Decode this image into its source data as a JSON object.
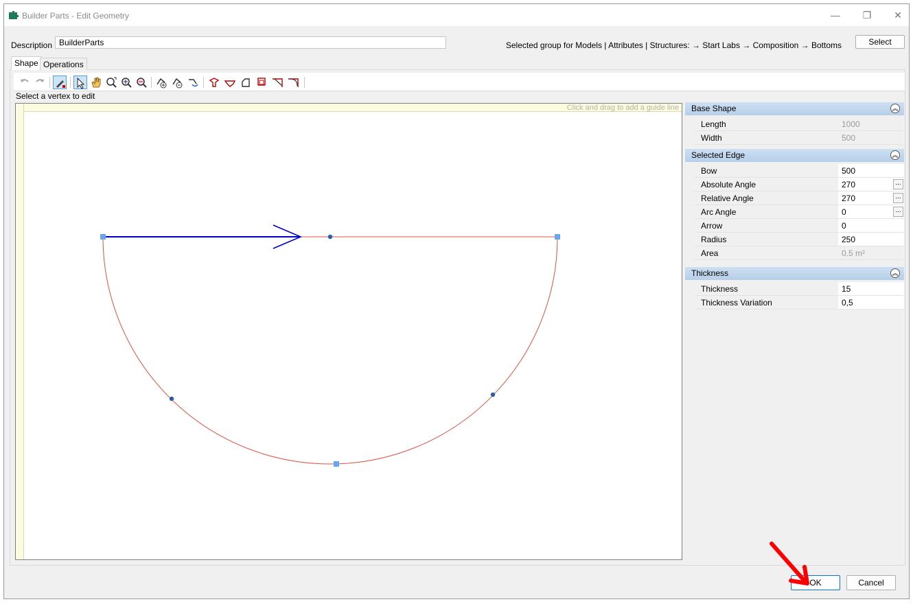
{
  "window": {
    "title": "Builder Parts - Edit Geometry",
    "controls": {
      "minimize": "—",
      "restore": "❐",
      "close": "✕"
    }
  },
  "description": {
    "label": "Description",
    "value": "BuilderParts"
  },
  "group": {
    "text": "Selected group for Models | Attributes | Structures:  → Start Labs → Composition → Bottoms",
    "select_label": "Select"
  },
  "tabs": [
    {
      "label": "Shape",
      "active": true
    },
    {
      "label": "Operations",
      "active": false
    }
  ],
  "toolbar": {
    "icons": [
      "undo-icon",
      "redo-icon",
      "edit-vertex-icon",
      "select-pointer-icon",
      "pan-hand-icon",
      "zoom-fit-icon",
      "zoom-in-icon",
      "zoom-out-icon",
      "add-vertex-icon",
      "remove-vertex-icon",
      "split-edge-icon",
      "corner-shape-1-icon",
      "corner-shape-2-icon",
      "corner-shape-3-icon",
      "corner-shape-4-icon",
      "chamfer-icon",
      "fillet-icon"
    ]
  },
  "hint": "Select a vertex to edit",
  "canvas": {
    "guide_hint": "Click and drag to add a guide line"
  },
  "properties": {
    "base_shape": {
      "title": "Base Shape",
      "rows": [
        {
          "name": "Length",
          "value": "1000"
        },
        {
          "name": "Width",
          "value": "500"
        }
      ]
    },
    "selected_edge": {
      "title": "Selected Edge",
      "rows": [
        {
          "name": "Bow",
          "value": "500"
        },
        {
          "name": "Absolute Angle",
          "value": "270"
        },
        {
          "name": "Relative Angle",
          "value": "270"
        },
        {
          "name": "Arc Angle",
          "value": "0"
        },
        {
          "name": "Arrow",
          "value": "0"
        },
        {
          "name": "Radius",
          "value": "250"
        },
        {
          "name": "Area",
          "value": "0.5 m²"
        }
      ]
    },
    "thickness": {
      "title": "Thickness",
      "rows": [
        {
          "name": "Thickness",
          "value": "15"
        },
        {
          "name": "Thickness Variation",
          "value": "0,5"
        }
      ]
    },
    "collapse_glyph": "︽",
    "dots_glyph": "..."
  },
  "buttons": {
    "ok": "OK",
    "cancel": "Cancel"
  },
  "colors": {
    "shape_edge": "#e05040",
    "selected_edge": "#0000cc",
    "vertex_handle": "#6aa6ee",
    "midpoint": "#2a5ea8",
    "annotation_arrow": "#ff0000"
  }
}
